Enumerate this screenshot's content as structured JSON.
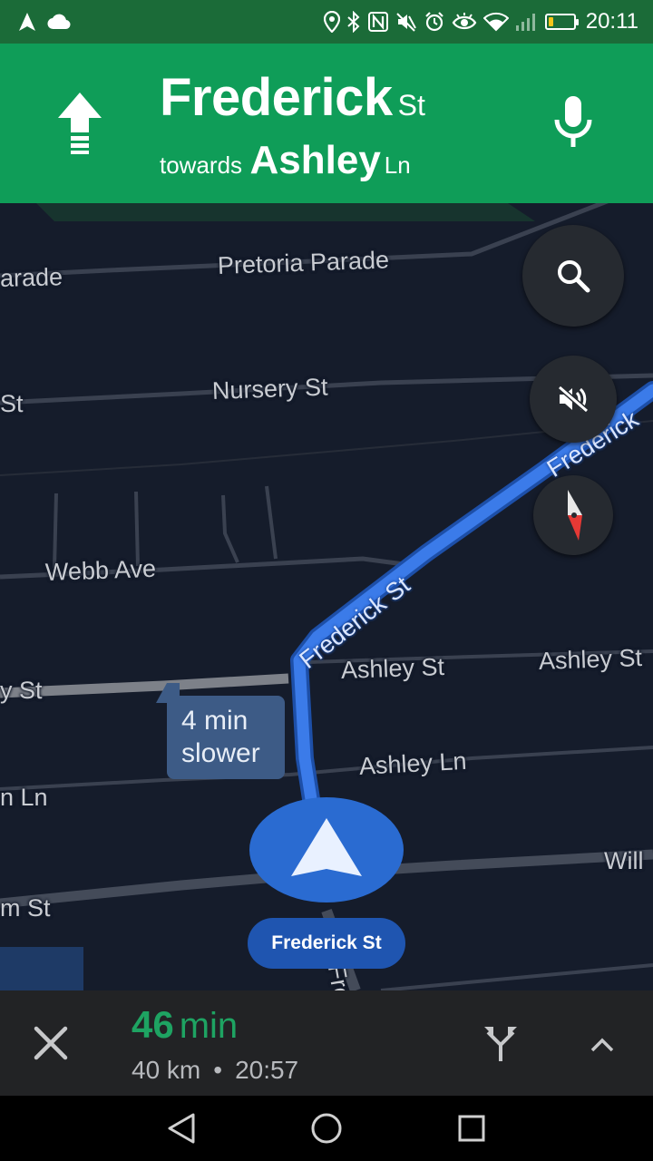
{
  "status_bar": {
    "time": "20:11",
    "battery_level": 0.18,
    "icons": [
      "navigation-arrow-icon",
      "cloud-icon",
      "location-icon",
      "bluetooth-icon",
      "nfc-icon",
      "vibrate-off-icon",
      "alarm-icon",
      "eye-comfort-icon",
      "wifi-icon",
      "signal-icon",
      "battery-icon"
    ]
  },
  "navigation": {
    "street_name": "Frederick",
    "street_suffix": "St",
    "towards_word": "towards",
    "towards_name": "Ashley",
    "towards_suffix": "Ln",
    "turn_icon": "straight-arrow-icon",
    "mic_icon": "microphone-icon",
    "header_color": "#0f9d58"
  },
  "map": {
    "labels": {
      "parade_left": "arade",
      "pretoria_parade": "Pretoria Parade",
      "st_left": "St",
      "nursery_st": "Nursery St",
      "frederick_top": "Frederick",
      "webb_ave": "Webb Ave",
      "frederick_route": "Frederick St",
      "y_st": "y St",
      "ashley_st_1": "Ashley St",
      "ashley_st_2": "Ashley St",
      "ashley_ln": "Ashley Ln",
      "n_ln": "n Ln",
      "will": "Will",
      "m_st": "m St",
      "fre_bottom": "Fre"
    },
    "delay_bubble": {
      "line1": "4 min",
      "line2": "slower"
    },
    "current_street": "Frederick St",
    "route_color": "#3b7be9",
    "buttons": {
      "search_icon": "search-icon",
      "mute_icon": "volume-off-icon",
      "compass_icon": "compass-icon"
    }
  },
  "trip": {
    "duration_value": "46",
    "duration_unit": "min",
    "distance": "40 km",
    "separator": "•",
    "arrival_time": "20:57",
    "eta_color": "#1ea362"
  },
  "system_nav": {
    "back_icon": "back-triangle-icon",
    "home_icon": "home-circle-icon",
    "recents_icon": "recents-square-icon"
  }
}
